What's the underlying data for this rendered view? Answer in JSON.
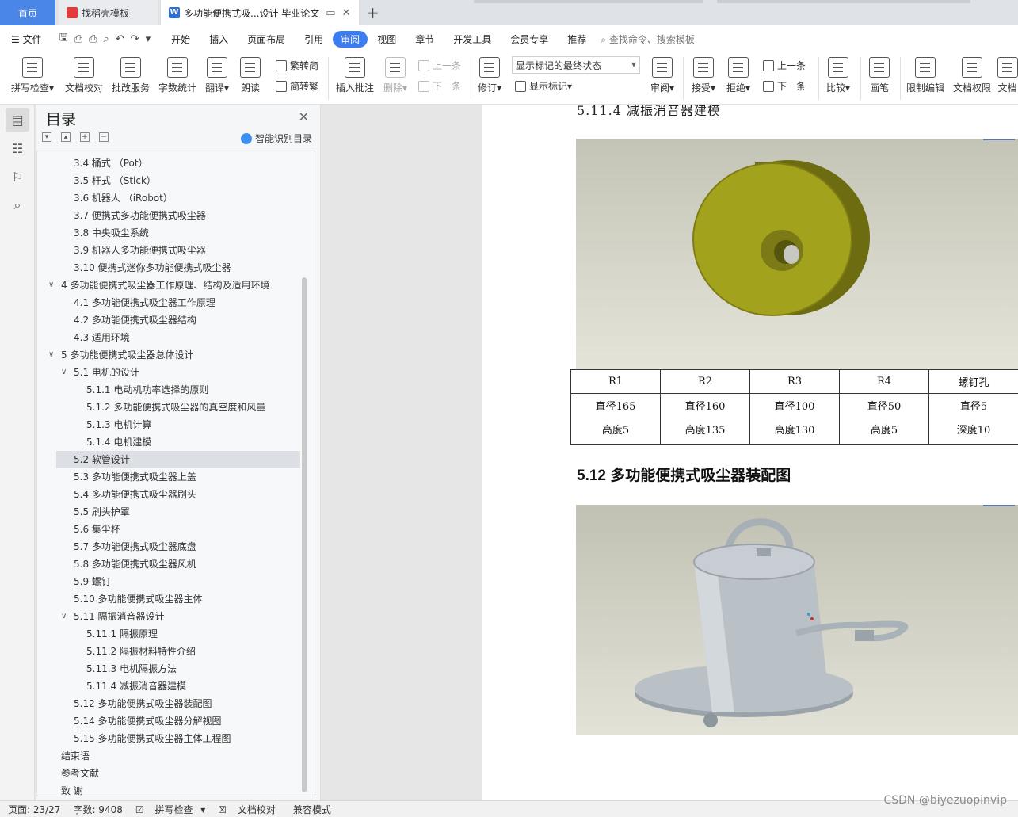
{
  "tabs": {
    "home": "首页",
    "wps": "找稻壳模板",
    "doc": "多功能便携式吸...设计 毕业论文"
  },
  "menu": {
    "file": "文件",
    "items": [
      "开始",
      "插入",
      "页面布局",
      "引用",
      "审阅",
      "视图",
      "章节",
      "开发工具",
      "会员专享",
      "推荐"
    ],
    "active": "审阅",
    "search": "查找命令、搜索模板"
  },
  "ribbon": {
    "spell": "拼写检查",
    "proof": "文档校对",
    "review_service": "批改服务",
    "word_count": "字数统计",
    "translate": "翻译",
    "read": "朗读",
    "trad": "繁转简",
    "simp": "简转繁",
    "insert_comment": "插入批注",
    "delete": "删除",
    "prev": "上一条",
    "next": "下一条",
    "revise": "修订",
    "markup_select": "显示标记的最终状态",
    "show_markup": "显示标记",
    "review": "审阅",
    "accept": "接受",
    "reject": "拒绝",
    "prev2": "上一条",
    "next2": "下一条",
    "compare": "比较",
    "pen": "画笔",
    "restrict": "限制编辑",
    "doc_rights": "文档权限",
    "doc_cut": "文档"
  },
  "toc": {
    "title": "目录",
    "smart": "智能识别目录",
    "items": [
      {
        "text": "3.4  桶式  （Pot）",
        "indent": 2
      },
      {
        "text": "3.5  杆式  （Stick）",
        "indent": 2
      },
      {
        "text": "3.6  机器人  （iRobot）",
        "indent": 2
      },
      {
        "text": "3.7 便携式多功能便携式吸尘器",
        "indent": 2
      },
      {
        "text": "3.8 中央吸尘系统",
        "indent": 2
      },
      {
        "text": "3.9 机器人多功能便携式吸尘器",
        "indent": 2
      },
      {
        "text": "3.10 便携式迷你多功能便携式吸尘器",
        "indent": 2
      },
      {
        "text": "4  多功能便携式吸尘器工作原理、结构及适用环境",
        "indent": 1,
        "caret": true
      },
      {
        "text": "4.1  多功能便携式吸尘器工作原理",
        "indent": 2
      },
      {
        "text": "4.2  多功能便携式吸尘器结构",
        "indent": 2
      },
      {
        "text": "4.3  适用环境",
        "indent": 2
      },
      {
        "text": "5  多功能便携式吸尘器总体设计",
        "indent": 1,
        "caret": true
      },
      {
        "text": "5.1 电机的设计",
        "indent": 2,
        "caret": true
      },
      {
        "text": "5.1.1 电动机功率选择的原则",
        "indent": 3
      },
      {
        "text": "5.1.2 多功能便携式吸尘器的真空度和风量",
        "indent": 3
      },
      {
        "text": "5.1.3 电机计算",
        "indent": 3
      },
      {
        "text": "5.1.4 电机建模",
        "indent": 3
      },
      {
        "text": "5.2 软管设计",
        "indent": 2,
        "selected": true
      },
      {
        "text": "5.3 多功能便携式吸尘器上盖",
        "indent": 2
      },
      {
        "text": "5.4 多功能便携式吸尘器刷头",
        "indent": 2
      },
      {
        "text": "5.5 刷头护罩",
        "indent": 2
      },
      {
        "text": "5.6 集尘杯",
        "indent": 2
      },
      {
        "text": "5.7 多功能便携式吸尘器底盘",
        "indent": 2
      },
      {
        "text": "5.8 多功能便携式吸尘器风机",
        "indent": 2
      },
      {
        "text": "5.9 螺钉",
        "indent": 2
      },
      {
        "text": "5.10 多功能便携式吸尘器主体",
        "indent": 2
      },
      {
        "text": "5.11 隔振消音器设计",
        "indent": 2,
        "caret": true
      },
      {
        "text": "5.11.1 隔振原理",
        "indent": 3
      },
      {
        "text": "5.11.2 隔振材料特性介绍",
        "indent": 3
      },
      {
        "text": "5.11.3 电机隔振方法",
        "indent": 3
      },
      {
        "text": "5.11.4 减振消音器建模",
        "indent": 3
      },
      {
        "text": "5.12 多功能便携式吸尘器装配图",
        "indent": 2
      },
      {
        "text": "5.14 多功能便携式吸尘器分解视图",
        "indent": 2
      },
      {
        "text": "5.15 多功能便携式吸尘器主体工程图",
        "indent": 2
      },
      {
        "text": "结束语",
        "indent": 1
      },
      {
        "text": "参考文献",
        "indent": 1
      },
      {
        "text": "致    谢",
        "indent": 1
      }
    ]
  },
  "document": {
    "heading_top": "5.11.4 减振消音器建模",
    "table": {
      "headers": [
        "R1",
        "R2",
        "R3",
        "R4",
        "螺钉孔"
      ],
      "row1": [
        "直径165",
        "直径160",
        "直径100",
        "直径50",
        "直径5"
      ],
      "row2": [
        "高度5",
        "高度135",
        "高度130",
        "高度5",
        "深度10"
      ]
    },
    "heading_main": "5.12 多功能便携式吸尘器装配图"
  },
  "status": {
    "page": "页面: 23/27",
    "words": "字数: 9408",
    "spell": "拼写检查",
    "proof": "文档校对",
    "compat": "兼容模式"
  },
  "watermark": "CSDN @biyezuopinvip",
  "colors": {
    "accent": "#3b7cf0",
    "damper": "#a3a21c",
    "vacuum_body": "#b9c0c6"
  }
}
